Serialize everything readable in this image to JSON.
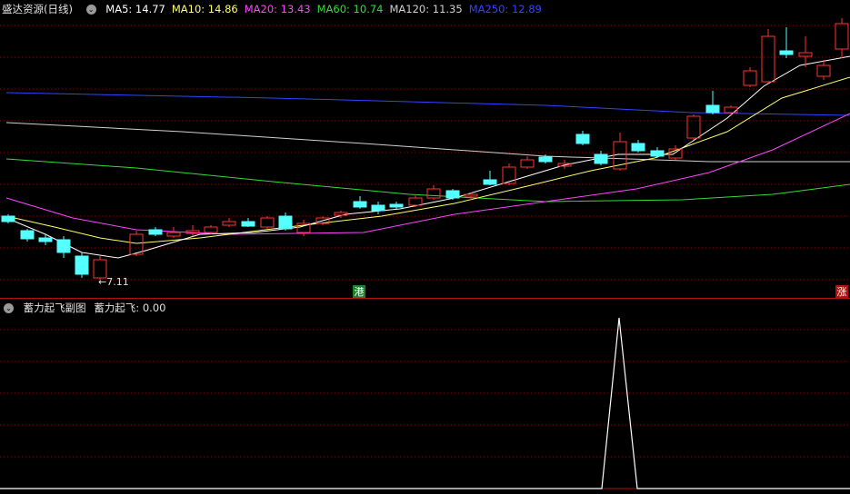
{
  "main": {
    "title": "盛达资源(日线)",
    "ma_labels": [
      {
        "text": "MA5: 14.77",
        "color": "#ffffff"
      },
      {
        "text": "MA10: 14.86",
        "color": "#ffff66"
      },
      {
        "text": "MA20: 13.43",
        "color": "#ff44ff"
      },
      {
        "text": "MA60: 10.74",
        "color": "#33dd33"
      },
      {
        "text": "MA120: 11.35",
        "color": "#d0d0d0"
      },
      {
        "text": "MA250: 12.89",
        "color": "#3344ff"
      }
    ],
    "low_label": "←7.11",
    "markers": {
      "gang": "港",
      "zhang": "涨"
    }
  },
  "sub": {
    "title": "蓄力起飞副图",
    "indicator": "蓄力起飞: 0.00"
  },
  "colors": {
    "up": "#ff3333",
    "down": "#54ffff",
    "grid": "#8b0000",
    "border": "#b01010",
    "background": "#000000",
    "ma5": "#ffffff",
    "ma10": "#ffff66",
    "ma20": "#ff44ff",
    "ma60": "#33dd33",
    "ma120": "#d0d0d0",
    "ma250": "#3344ff"
  },
  "chart_data": {
    "type": "candlestick",
    "series": [
      {
        "name": "MA5",
        "values": [
          14.77
        ]
      },
      {
        "name": "MA10",
        "values": [
          14.86
        ]
      },
      {
        "name": "MA20",
        "values": [
          13.43
        ]
      },
      {
        "name": "MA60",
        "values": [
          10.74
        ]
      },
      {
        "name": "MA120",
        "values": [
          11.35
        ]
      },
      {
        "name": "MA250",
        "values": [
          12.89
        ]
      }
    ],
    "annotations": [
      "7.11"
    ],
    "sub_indicator": {
      "name": "蓄力起飞",
      "value": 0.0
    }
  }
}
